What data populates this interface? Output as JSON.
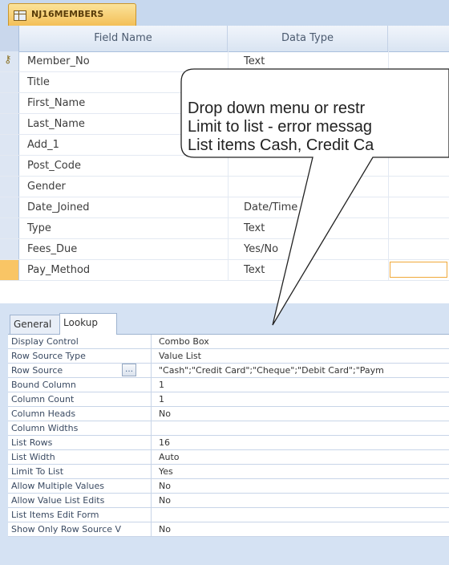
{
  "object_tab": {
    "title": "NJ16MEMBERS"
  },
  "grid": {
    "headers": {
      "field_name": "Field Name",
      "data_type": "Data Type"
    },
    "rows": [
      {
        "name": "Member_No",
        "type": "Text",
        "key": true
      },
      {
        "name": "Title",
        "type": ""
      },
      {
        "name": "First_Name",
        "type": ""
      },
      {
        "name": "Last_Name",
        "type": ""
      },
      {
        "name": "Add_1",
        "type": ""
      },
      {
        "name": "Post_Code",
        "type": ""
      },
      {
        "name": "Gender",
        "type": ""
      },
      {
        "name": "Date_Joined",
        "type": "Date/Time"
      },
      {
        "name": "Type",
        "type": "Text"
      },
      {
        "name": "Fees_Due",
        "type": "Yes/No"
      },
      {
        "name": "Pay_Method",
        "type": "Text",
        "active": true
      }
    ]
  },
  "properties": {
    "tabs": {
      "general": "General",
      "lookup": "Lookup"
    },
    "rows": [
      {
        "label": "Display Control",
        "value": "Combo Box"
      },
      {
        "label": "Row Source Type",
        "value": "Value List"
      },
      {
        "label": "Row Source",
        "value": "\"Cash\";\"Credit Card\";\"Cheque\";\"Debit Card\";\"Paym",
        "builder": true
      },
      {
        "label": "Bound Column",
        "value": "1"
      },
      {
        "label": "Column Count",
        "value": "1"
      },
      {
        "label": "Column Heads",
        "value": "No"
      },
      {
        "label": "Column Widths",
        "value": ""
      },
      {
        "label": "List Rows",
        "value": "16"
      },
      {
        "label": "List Width",
        "value": "Auto"
      },
      {
        "label": "Limit To List",
        "value": "Yes"
      },
      {
        "label": "Allow Multiple Values",
        "value": "No"
      },
      {
        "label": "Allow Value List Edits",
        "value": "No"
      },
      {
        "label": "List Items Edit Form",
        "value": ""
      },
      {
        "label": "Show Only Row Source V",
        "value": "No"
      }
    ]
  },
  "callout": {
    "lines": [
      "Drop down menu or restr",
      "Limit to list - error messag",
      "List items Cash, Credit Ca"
    ]
  },
  "colors": {
    "tab_accent": "#f3bf58",
    "active_row": "#f9c565",
    "panel_bg": "#d5e2f3"
  }
}
